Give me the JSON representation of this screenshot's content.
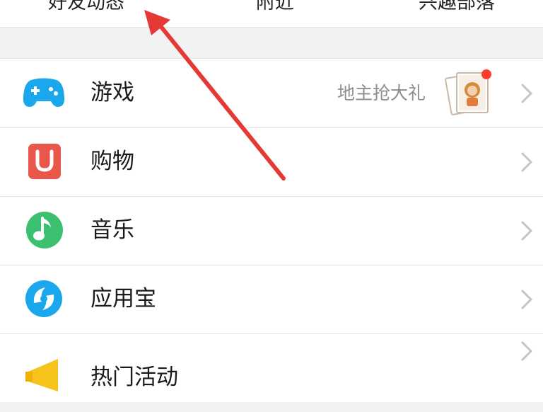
{
  "tabs": [
    "好友动态",
    "附近",
    "兴趣部落"
  ],
  "rows": [
    {
      "label": "游戏",
      "sub": "地主抢大礼",
      "icon": "gamepad-icon"
    },
    {
      "label": "购物",
      "icon": "shopping-bag-icon"
    },
    {
      "label": "音乐",
      "icon": "music-note-icon"
    },
    {
      "label": "应用宝",
      "icon": "app-store-icon"
    },
    {
      "label": "热门活动",
      "icon": "megaphone-icon"
    }
  ],
  "colors": {
    "accent_blue": "#1aa7ec",
    "shopping_red": "#e8574a",
    "music_green": "#3cc070",
    "activity_yellow": "#f6c31a",
    "annotation_red": "#e53935",
    "badge_red": "#ff3b30"
  },
  "annotation": {
    "type": "arrow",
    "color": "#e53935",
    "target": "tab-friend-updates"
  }
}
